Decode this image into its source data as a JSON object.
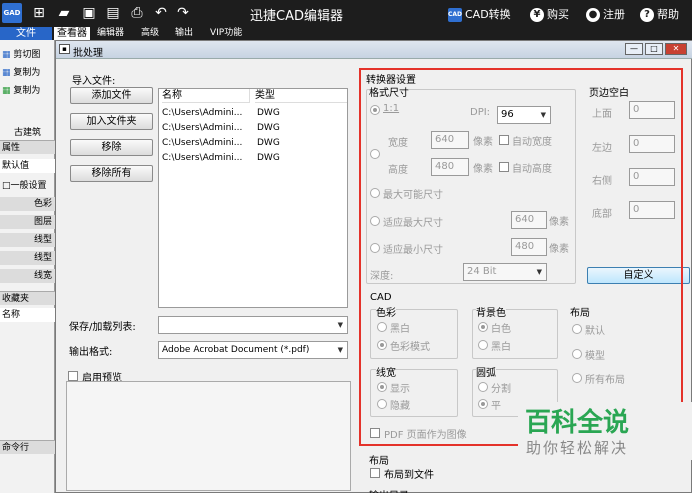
{
  "titlebar": {
    "logo_text": "GAD",
    "title": "迅捷CAD编辑器",
    "icons": [
      "add-icon",
      "folder-icon",
      "save-icon",
      "save-as-icon",
      "print-icon",
      "undo-icon",
      "redo-icon"
    ],
    "cad_convert": "CAD转换",
    "buy": "购买",
    "register": "注册",
    "help": "帮助"
  },
  "menu": {
    "file": "文件",
    "viewer": "查看器",
    "editor": "编辑器",
    "advanced": "高级",
    "output": "输出",
    "vip": "VIP功能"
  },
  "leftpanel": {
    "tool1": "剪切图",
    "tool2": "复制为",
    "tool3": "复制为",
    "section": "古建筑",
    "props_header": "属性",
    "default_value": "默认值",
    "general": "□一般设置",
    "color": "色彩",
    "layer": "图层",
    "linetype": "线型",
    "lineweight_scale": "线型",
    "lineweight": "线宽",
    "favorites": "收藏夹",
    "name": "名称",
    "command_line": "命令行"
  },
  "dialog": {
    "title": "批处理",
    "import_label": "导入文件:",
    "add_file": "添加文件",
    "add_folder": "加入文件夹",
    "remove": "移除",
    "remove_all": "移除所有",
    "columns": {
      "name": "名称",
      "type": "类型"
    },
    "files": [
      {
        "name": "C:\\Users\\Admini...",
        "type": "DWG"
      },
      {
        "name": "C:\\Users\\Admini...",
        "type": "DWG"
      },
      {
        "name": "C:\\Users\\Admini...",
        "type": "DWG"
      },
      {
        "name": "C:\\Users\\Admini...",
        "type": "DWG"
      }
    ],
    "save_list_label": "保存/加载列表:",
    "save_list_value": "",
    "output_format_label": "输出格式:",
    "output_format_value": "Adobe Acrobat Document (*.pdf)",
    "preview_label": "启用预览"
  },
  "converter": {
    "title": "转换器设置",
    "format_size": "格式尺寸",
    "ratio": "1:1",
    "dpi_label": "DPI:",
    "dpi_value": "96",
    "width_label": "宽度",
    "width_value": "640",
    "height_label": "高度",
    "height_value": "480",
    "pixel": "像素",
    "auto_width": "自动宽度",
    "auto_height": "自动高度",
    "max_size": "最大可能尺寸",
    "fit_max": "适应最大尺寸",
    "fit_max_value": "640",
    "fit_min": "适应最小尺寸",
    "fit_min_value": "480",
    "depth_label": "深度:",
    "depth_value": "24 Bit",
    "margins": "页边空白",
    "top": "上面",
    "top_value": "0",
    "left": "左边",
    "left_value": "0",
    "right": "右侧",
    "right_value": "0",
    "bottom": "底部",
    "bottom_value": "0",
    "custom": "自定义",
    "cad": "CAD",
    "color": "色彩",
    "bw": "黑白",
    "color_mode": "色彩模式",
    "bg_color": "背景色",
    "white": "白色",
    "black_white": "黑白",
    "layout": "布局",
    "default": "默认",
    "model": "模型",
    "all_layouts": "所有布局",
    "lineweight": "线宽",
    "show": "显示",
    "hide": "隐藏",
    "arc": "圆弧",
    "arc_opt1": "分割",
    "arc_opt2": "平",
    "pdf_as_image": "PDF 页面作为图像",
    "layout_section": "布局",
    "layout_to_file": "布局到文件",
    "output_dir": "输出目录"
  },
  "watermark": {
    "main": "百科全说",
    "sub": "助你轻松解决"
  },
  "colors": {
    "accent": "#2866c8",
    "highlight": "#e4322a",
    "watermark": "#2aa653"
  }
}
